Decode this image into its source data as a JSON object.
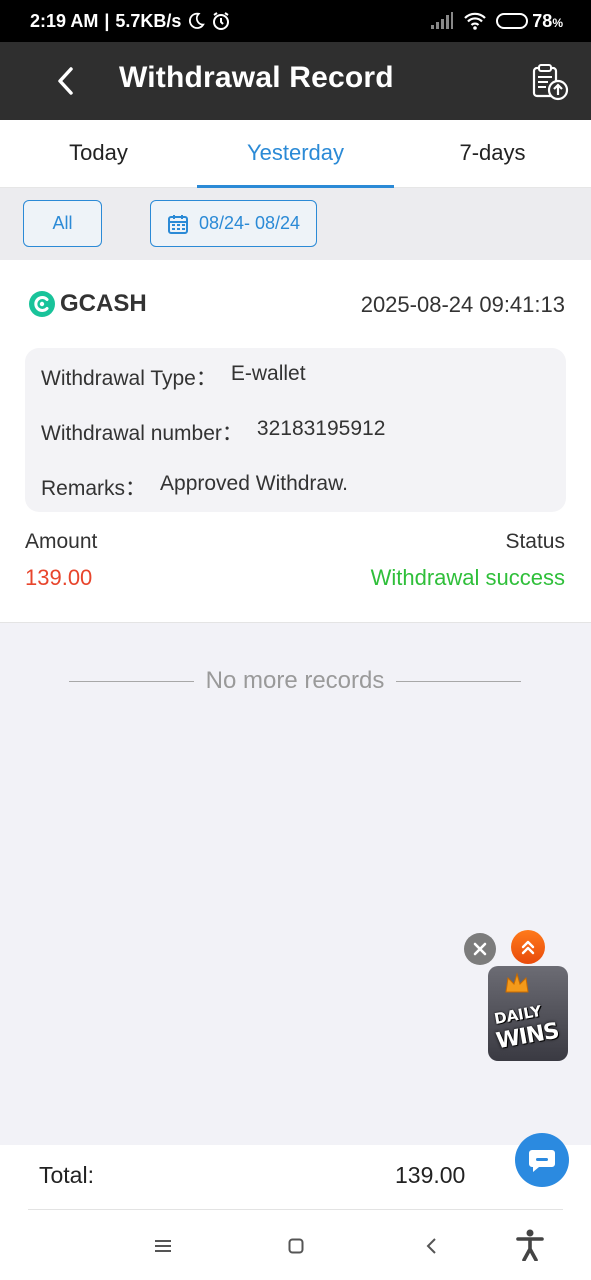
{
  "status_bar": {
    "time": "2:19 AM",
    "separator": "|",
    "net_speed": "5.7KB/s",
    "battery": "78",
    "battery_unit": "%",
    "battery_level": 0.78
  },
  "header": {
    "title": "Withdrawal Record"
  },
  "tabs": [
    {
      "label": "Today",
      "active": false
    },
    {
      "label": "Yesterday",
      "active": true
    },
    {
      "label": "7-days",
      "active": false
    }
  ],
  "filters": {
    "all_label": "All",
    "date_range": "08/24- 08/24"
  },
  "record": {
    "provider": "GCASH",
    "timestamp": "2025-08-24 09:41:13",
    "type_label": "Withdrawal Type：",
    "type_value": "E-wallet",
    "number_label": "Withdrawal number：",
    "number_value": "32183195912",
    "remarks_label": "Remarks：",
    "remarks_value": "Approved Withdraw.",
    "amount_label": "Amount",
    "amount_value": "139.00",
    "status_label": "Status",
    "status_value": "Withdrawal success"
  },
  "list_footer": "No more records",
  "promo": {
    "line1": "DAILY",
    "line2": "WINS"
  },
  "total": {
    "label": "Total:",
    "value": "139.00"
  },
  "colors": {
    "accent": "#2b8ad6",
    "amount": "#e8452c",
    "success": "#2fbf3a",
    "header_bg": "#2f2f2f",
    "gcash": "#19c39a"
  }
}
